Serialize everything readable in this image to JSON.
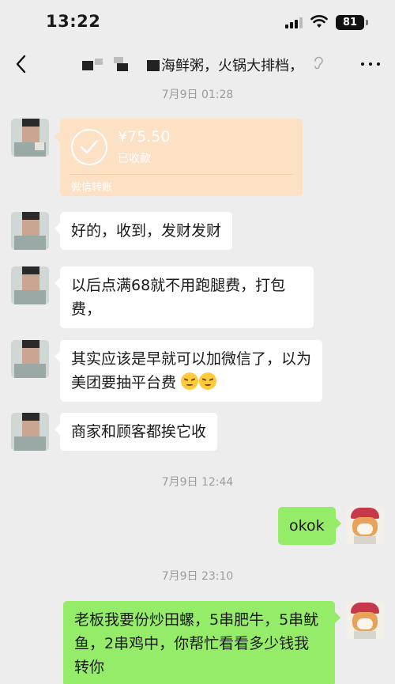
{
  "status_bar": {
    "time": "13:22",
    "battery": "81"
  },
  "nav": {
    "title": "海鲜粥，火锅大排档，"
  },
  "messages": {
    "ts1": "7月9日 01:28",
    "transfer": {
      "amount": "¥75.50",
      "status": "已收款",
      "footer": "微信转账"
    },
    "m1": "好的，收到，发财发财",
    "m2": "以后点满68就不用跑腿费，打包费，",
    "m3": "其实应该是早就可以加微信了，以为美团要抽平台费",
    "m4": "商家和顾客都挨它收",
    "ts2": "7月9日 12:44",
    "m5": "okok",
    "ts3": "7月9日 23:10",
    "m6": "老板我要份炒田螺，5串肥牛，5串鱿鱼，2串鸡中，你帮忙看看多少钱我转你"
  },
  "colors": {
    "background": "#ededed",
    "outgoing_bubble": "#95ec69",
    "incoming_bubble": "#ffffff",
    "transfer_card": "#fde1c4"
  },
  "icons": [
    "back-chevron-icon",
    "signal-icon",
    "wifi-icon",
    "battery-icon",
    "ear-icon",
    "more-icon",
    "checkmark-icon",
    "sad-face-emoji-icon"
  ]
}
